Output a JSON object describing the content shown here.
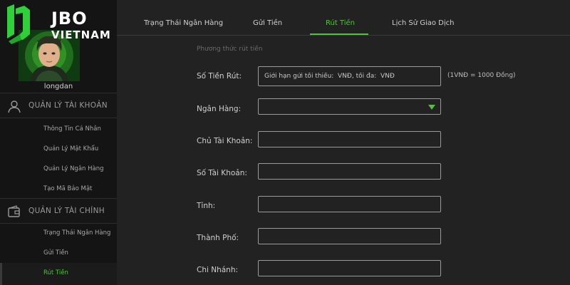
{
  "brand": {
    "logo_text": "JBO",
    "logo_sub": "VIETNAM"
  },
  "user": {
    "username": "longdan"
  },
  "sidebar": {
    "sections": [
      {
        "label": "QUẢN LÝ TÀI KHOẢN",
        "icon": "user-icon",
        "items": [
          "Thông Tin Cá Nhân",
          "Quản Lý Mật Khẩu",
          "Quản Lý Ngân Hàng",
          "Tạo Mã Bảo Mật"
        ]
      },
      {
        "label": "QUẢN LÝ TÀI CHÍNH",
        "icon": "wallet-icon",
        "items": [
          "Trạng Thái Ngân Hàng",
          "Gửi Tiền",
          "Rút Tiền"
        ]
      }
    ],
    "active_item": "Rút Tiền"
  },
  "tabs": [
    {
      "label": "Trạng Thái Ngân Hàng"
    },
    {
      "label": "Gửi Tiền"
    },
    {
      "label": "Rút Tiền"
    },
    {
      "label": "Lịch Sử Giao Dịch"
    }
  ],
  "active_tab": "Rút Tiền",
  "form": {
    "method_label": "Phương thức rút tiền",
    "amount_label": "Số Tiền Rút:",
    "amount_placeholder": "Giới hạn gửi tối thiểu:  VNĐ, tối đa:  VNĐ",
    "amount_value": "",
    "rate_note": "(1VNĐ = 1000 Đồng)",
    "bank_label": "Ngân Hàng:",
    "bank_value": "",
    "holder_label": "Chủ Tài Khoản:",
    "holder_value": "",
    "account_label": "Số Tài Khoản:",
    "account_value": "",
    "province_label": "Tỉnh:",
    "province_value": "",
    "city_label": "Thành Phố:",
    "city_value": "",
    "branch_label": "Chi Nhánh:",
    "branch_value": ""
  },
  "colors": {
    "accent": "#4fc23a",
    "background": "#222222",
    "sidebar": "#141414"
  }
}
